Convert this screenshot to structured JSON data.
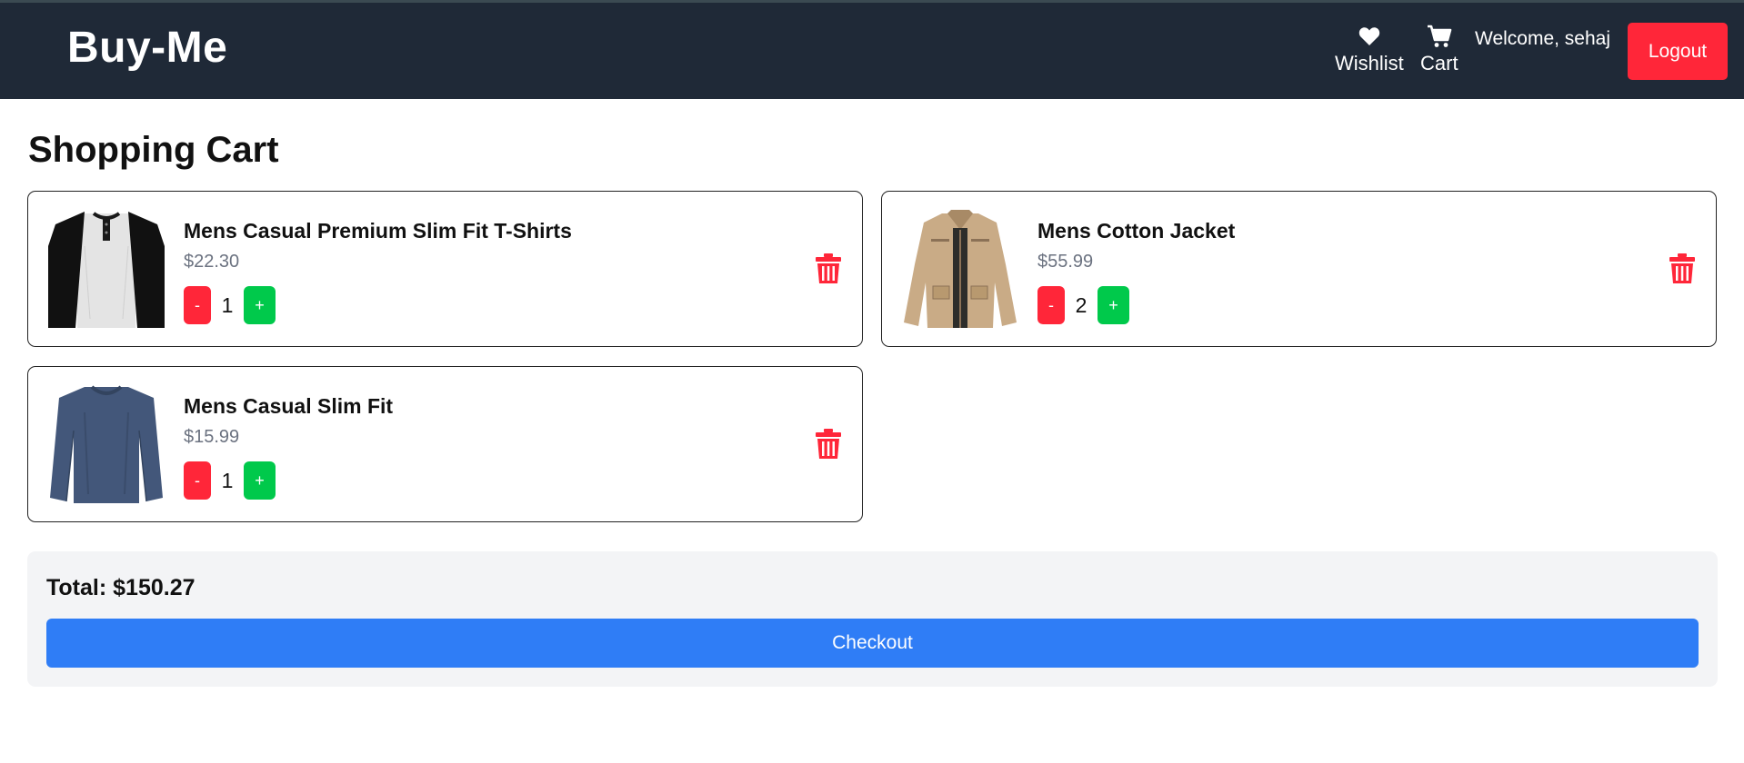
{
  "header": {
    "brand": "Buy-Me",
    "wishlist_label": "Wishlist",
    "cart_label": "Cart",
    "welcome_text": "Welcome, sehaj",
    "logout_label": "Logout"
  },
  "page": {
    "title": "Shopping Cart"
  },
  "cart": {
    "items": [
      {
        "title": "Mens Casual Premium Slim Fit T-Shirts",
        "price": "$22.30",
        "quantity": "1",
        "minus_label": "-",
        "plus_label": "+",
        "image_icon": "raglan-tshirt-image"
      },
      {
        "title": "Mens Cotton Jacket",
        "price": "$55.99",
        "quantity": "2",
        "minus_label": "-",
        "plus_label": "+",
        "image_icon": "jacket-image"
      },
      {
        "title": "Mens Casual Slim Fit",
        "price": "$15.99",
        "quantity": "1",
        "minus_label": "-",
        "plus_label": "+",
        "image_icon": "longsleeve-shirt-image"
      }
    ]
  },
  "summary": {
    "total_text": "Total: $150.27",
    "checkout_label": "Checkout"
  },
  "colors": {
    "navbar_bg": "#1f2937",
    "danger": "#ff2639",
    "success": "#00c94b",
    "primary": "#2f7df6",
    "panel_bg": "#f3f4f6"
  }
}
